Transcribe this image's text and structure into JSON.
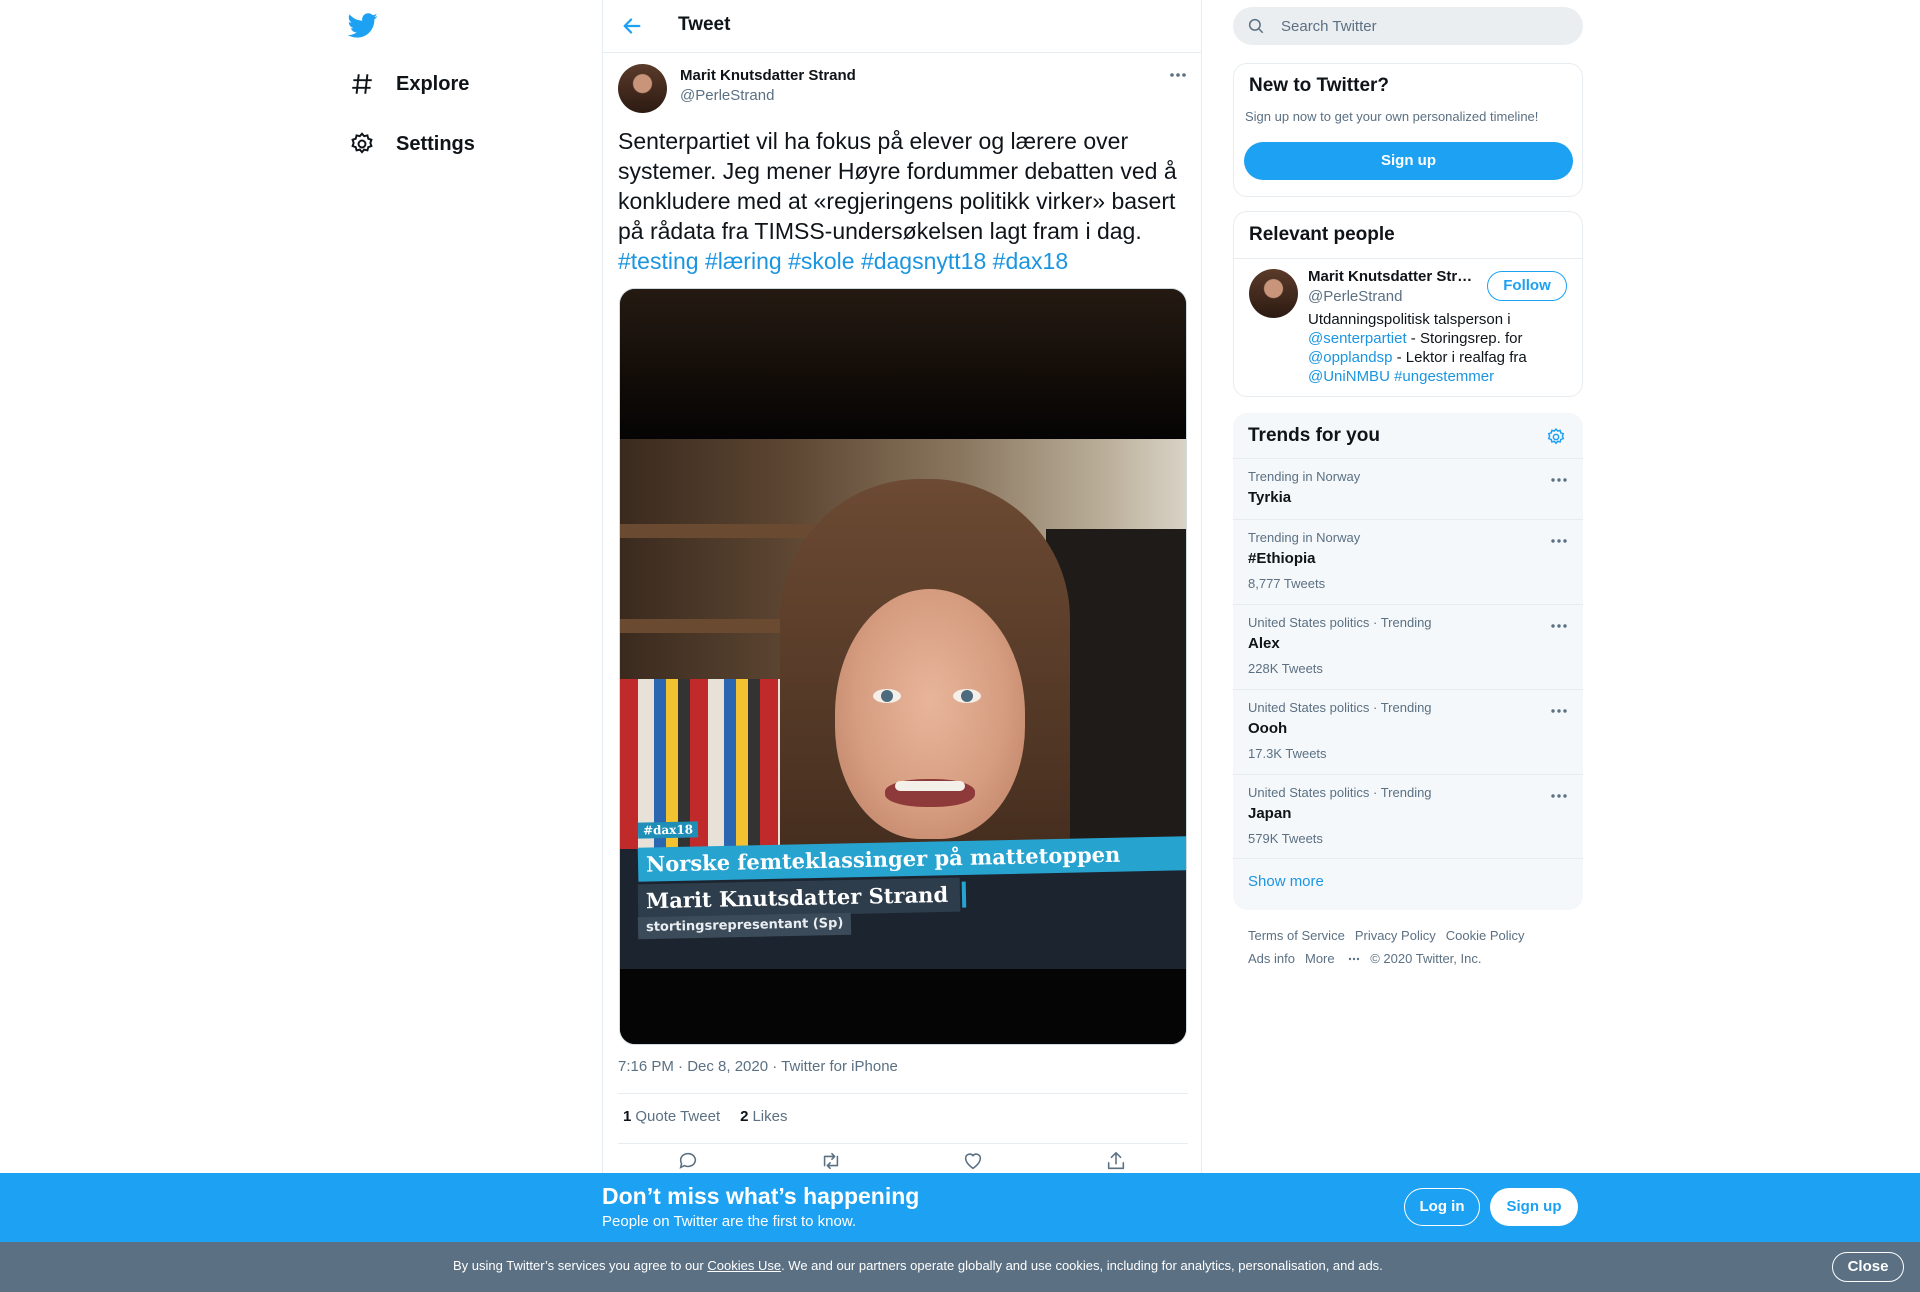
{
  "colors": {
    "accent": "#1da1f2",
    "link": "#1b95e0",
    "muted": "#5b7083",
    "cookie_bar": "#5b7083"
  },
  "nav": {
    "logo_icon": "twitter-bird-icon",
    "items": [
      {
        "label": "Explore",
        "icon": "hashtag-icon"
      },
      {
        "label": "Settings",
        "icon": "gear-icon"
      }
    ]
  },
  "header": {
    "back_icon": "arrow-left-icon",
    "title": "Tweet"
  },
  "tweet": {
    "author_name": "Marit Knutsdatter Strand",
    "author_handle": "@PerleStrand",
    "text": "Senterpartiet vil ha fokus på elever og lærere over systemer. Jeg mener Høyre fordummer debatten ved å konkludere med at «regjeringens politikk virker» basert på rådata fra TIMSS-undersøkelsen lagt fram i dag.",
    "hashtags": [
      "#testing",
      "#læring",
      "#skole",
      "#dagsnytt18",
      "#dax18"
    ],
    "media_overlay": {
      "tag": "#dax18",
      "headline": "Norske femteklassinger på mattetoppen",
      "name": "Marit Knutsdatter Strand",
      "role": "stortingsrepresentant (Sp)"
    },
    "time": "7:16 PM · Dec 8, 2020",
    "sep": " · ",
    "source": "Twitter for iPhone",
    "quote_count": "1",
    "quote_label": "Quote Tweet",
    "like_count": "2",
    "like_label": "Likes",
    "actions": [
      "reply-icon",
      "retweet-icon",
      "like-icon",
      "share-icon"
    ]
  },
  "search": {
    "placeholder": "Search Twitter"
  },
  "new_to_twitter": {
    "title": "New to Twitter?",
    "subtitle": "Sign up now to get your own personalized timeline!",
    "button": "Sign up"
  },
  "relevant": {
    "title": "Relevant people",
    "name": "Marit Knutsdatter Str…",
    "handle": "@PerleStrand",
    "follow": "Follow",
    "bio": {
      "p1": "Utdanningspolitisk talsperson i ",
      "link1": "@senterpartiet",
      "p2": " - Storingsrep. for ",
      "link2": "@opplandsp",
      "p3": " - Lektor i realfag fra ",
      "link3": "@UniNMBU",
      "p4": " ",
      "link4": "#ungestemmer"
    }
  },
  "trends": {
    "title": "Trends for you",
    "items": [
      {
        "context": "Trending in Norway",
        "name": "Tyrkia",
        "count": ""
      },
      {
        "context": "Trending in Norway",
        "name": "#Ethiopia",
        "count": "8,777 Tweets"
      },
      {
        "context": "United States politics · Trending",
        "name": "Alex",
        "count": "228K Tweets"
      },
      {
        "context": "United States politics · Trending",
        "name": "Oooh",
        "count": "17.3K Tweets"
      },
      {
        "context": "United States politics · Trending",
        "name": "Japan",
        "count": "579K Tweets"
      }
    ],
    "show_more": "Show more"
  },
  "footer": {
    "links": [
      "Terms of Service",
      "Privacy Policy",
      "Cookie Policy",
      "Ads info",
      "More"
    ],
    "copyright": "© 2020 Twitter, Inc."
  },
  "banner": {
    "title": "Don’t miss what’s happening",
    "subtitle": "People on Twitter are the first to know.",
    "login": "Log in",
    "signup": "Sign up"
  },
  "cookie": {
    "prefix": "By using Twitter’s services you agree to our ",
    "link": "Cookies Use",
    "suffix": ". We and our partners operate globally and use cookies, including for analytics, personalisation, and ads.",
    "close": "Close"
  }
}
